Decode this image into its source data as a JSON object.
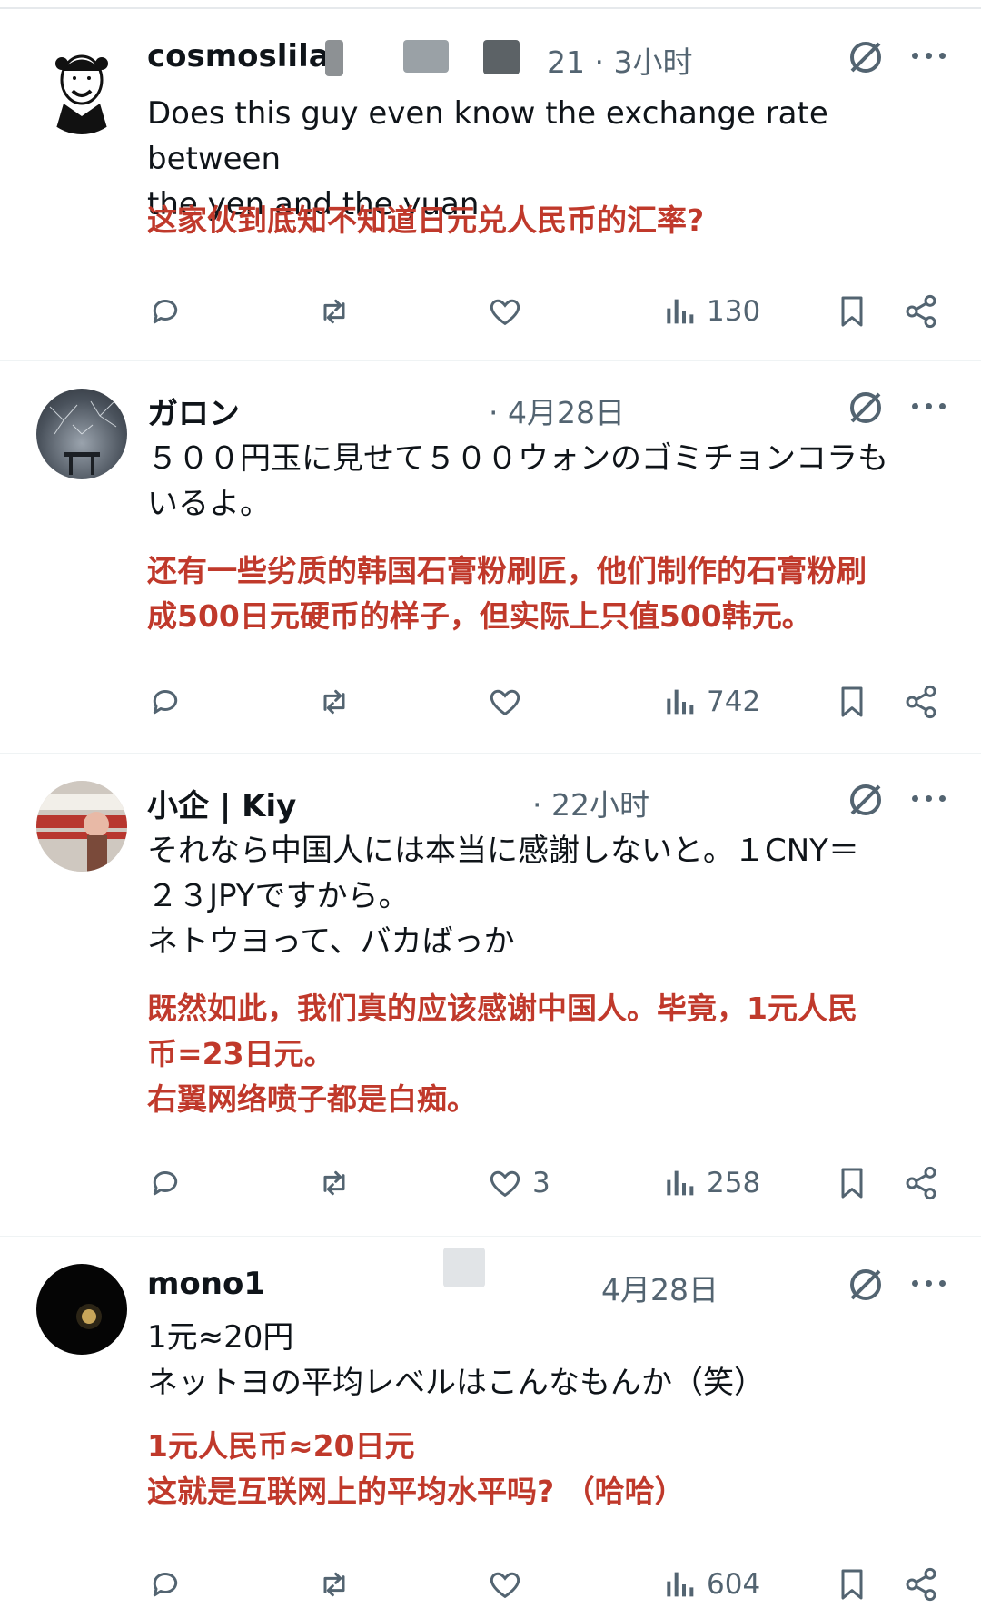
{
  "posts": [
    {
      "username": "cosmoslila",
      "meta": "·2021 · 3小时",
      "meta_shown": "21 · 3小时",
      "text": "Does this guy even know the exchange rate between\nthe yen and the yuan",
      "translation": "这家伙到底知不知道日元兑人民币的汇率?",
      "likes": "",
      "views": "130"
    },
    {
      "username": "ガロン",
      "meta_shown": "· 4月28日",
      "text": "５００円玉に見せて５００ウォンのゴミチョンコラも\nいるよ。",
      "translation": "还有一些劣质的韩国石膏粉刷匠，他们制作的石膏粉刷\n成500日元硬币的样子，但实际上只值500韩元。",
      "likes": "",
      "views": "742"
    },
    {
      "username": "小企 | Kiy",
      "meta_shown": "· 22小时",
      "text": "それなら中国人には本当に感謝しないと。１CNY＝\n２３JPYですから。\nネトウヨって、バカばっか",
      "translation": "既然如此，我们真的应该感谢中国人。毕竟，1元人民\n币=23日元。\n右翼网络喷子都是白痴。",
      "likes": "3",
      "views": "258"
    },
    {
      "username": "mono1",
      "meta_shown": "4月28日",
      "text": "1元≈20円\nネットヨの平均レベルはこんなもんか（笑）",
      "translation": "1元人民币≈20日元\n这就是互联网上的平均水平吗? （哈哈）",
      "likes": "",
      "views": "604"
    }
  ],
  "icons": {
    "reply": "reply-icon",
    "repost": "repost-icon",
    "like": "heart-icon",
    "views": "views-icon",
    "bookmark": "bookmark-icon",
    "share": "share-icon",
    "grok": "grok-icon",
    "more": "more-icon"
  },
  "colors": {
    "text": "#0f1419",
    "muted": "#536471",
    "translation": "#c0392b",
    "divider": "#eff3f4"
  }
}
